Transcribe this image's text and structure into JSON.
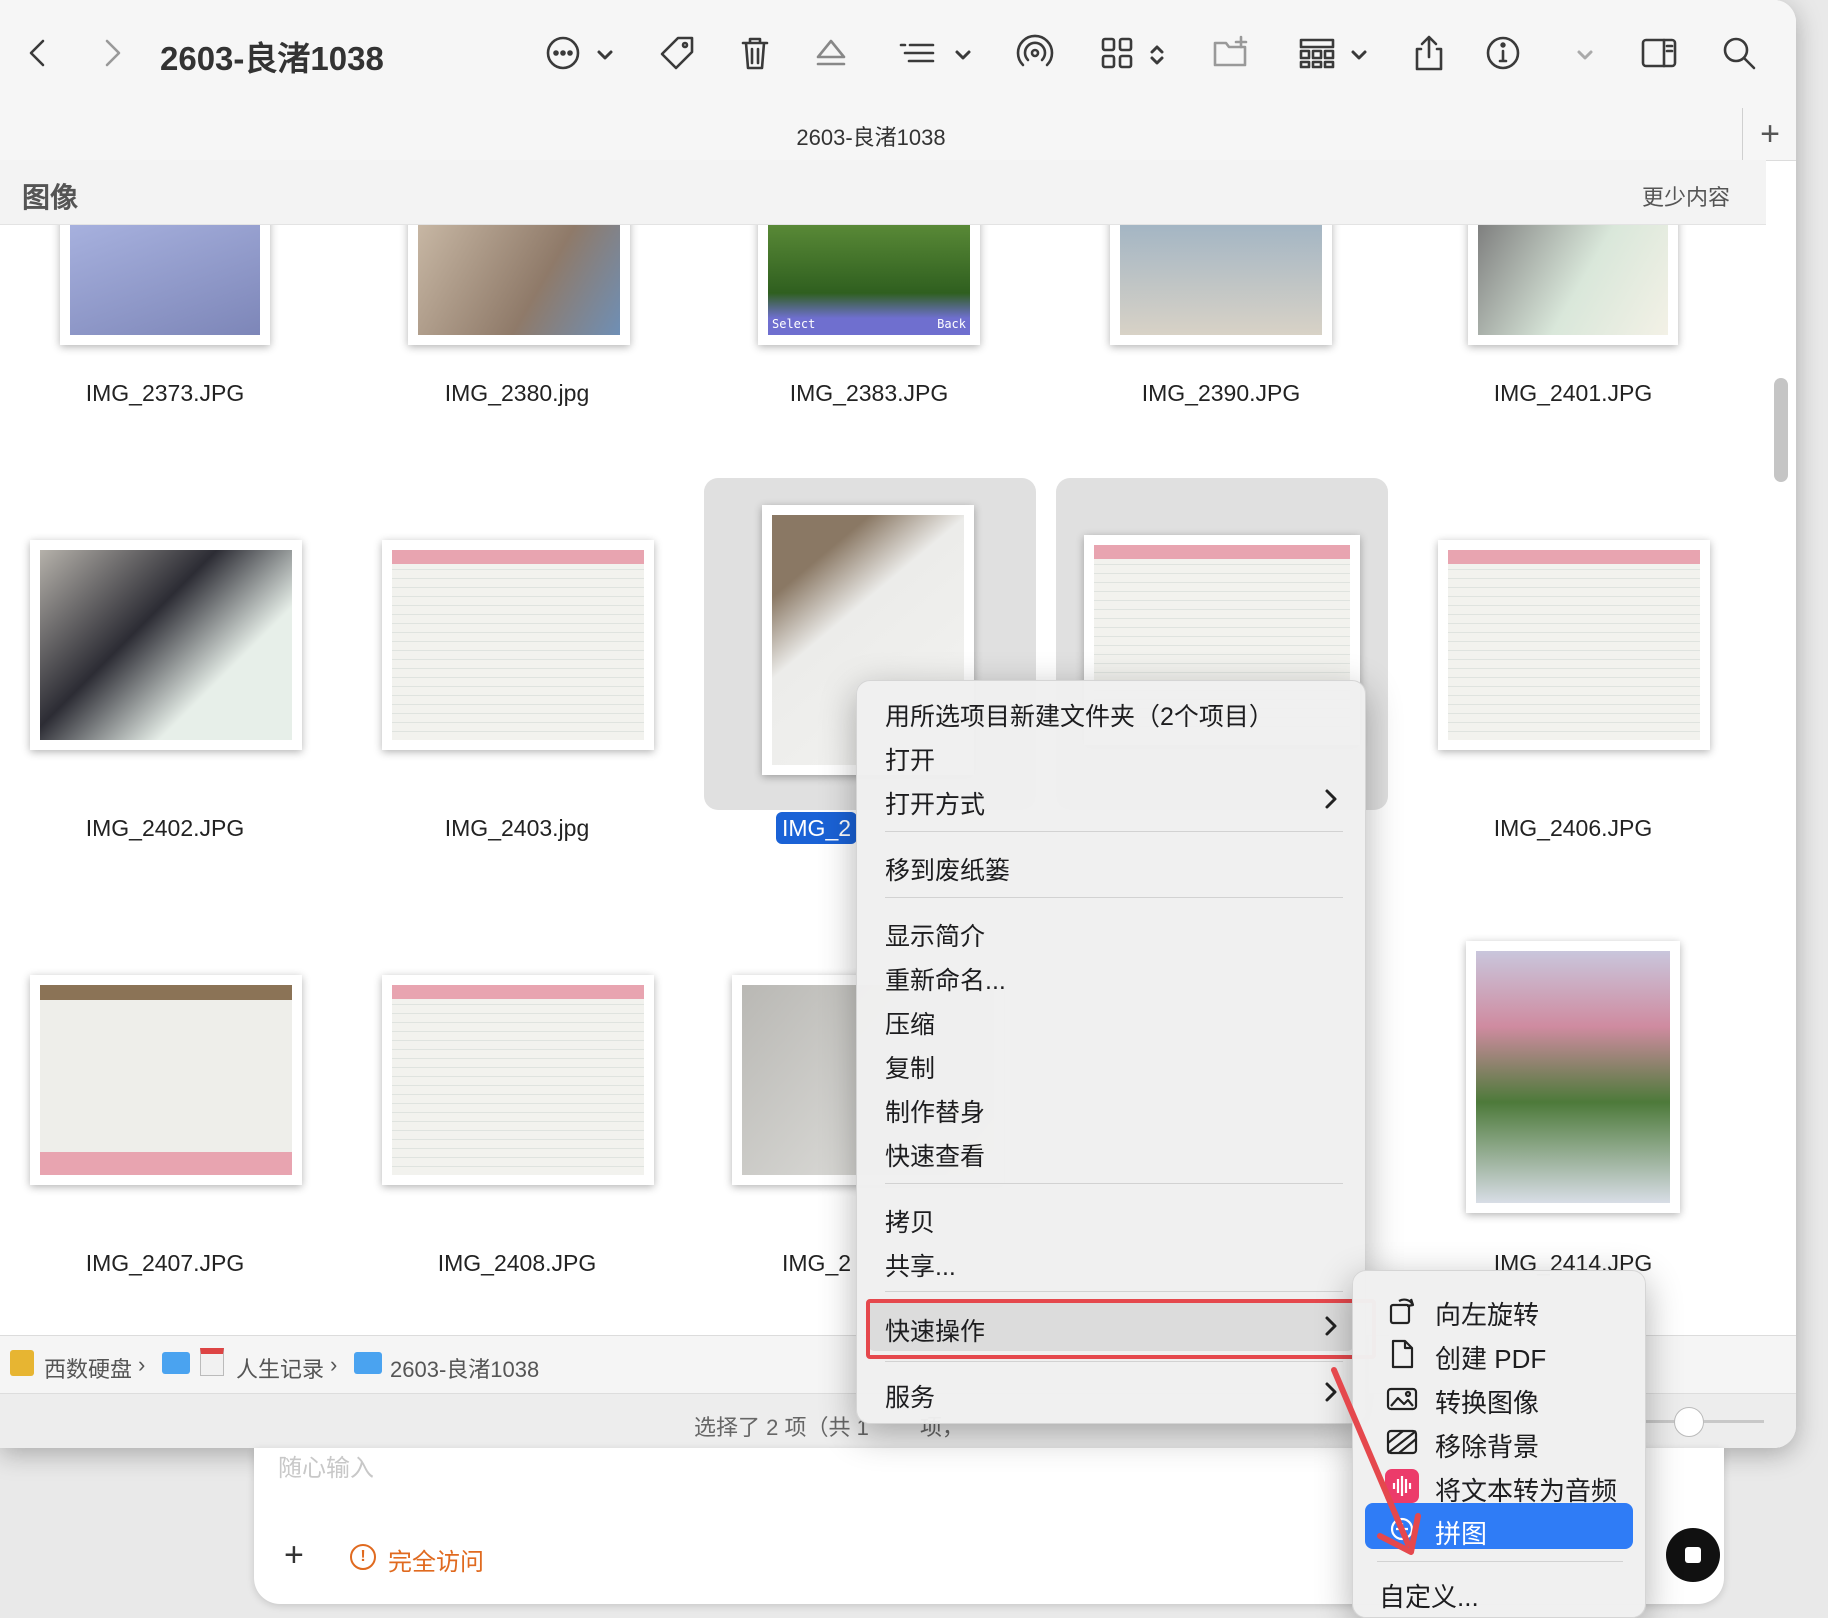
{
  "window": {
    "title": "2603-良渚1038",
    "tab_title": "2603-良渚1038",
    "tab_add": "+",
    "section_title": "图像",
    "section_less": "更少内容"
  },
  "toolbar_icons": [
    "back-icon",
    "forward-icon",
    "more-actions-icon",
    "tag-icon",
    "trash-icon",
    "eject-icon",
    "group-by-icon",
    "airdrop-icon",
    "view-mode-icon",
    "new-folder-icon",
    "gallery-view-icon",
    "share-icon",
    "info-icon",
    "sidebar-toggle-icon",
    "search-icon"
  ],
  "files": {
    "row1": [
      "IMG_2373.JPG",
      "IMG_2380.jpg",
      "IMG_2383.JPG",
      "IMG_2390.JPG",
      "IMG_2401.JPG"
    ],
    "row2": [
      "IMG_2402.JPG",
      "IMG_2403.jpg",
      "IMG_2",
      "",
      "IMG_2406.JPG"
    ],
    "row3": [
      "IMG_2407.JPG",
      "IMG_2408.JPG",
      "IMG_2",
      "",
      "IMG_2414.JPG"
    ],
    "thumb_caption_left": "Select",
    "thumb_caption_right": "Back"
  },
  "pathbar": [
    "西数硬盘",
    "人生记录",
    "2603-良渚1038"
  ],
  "status": "选择了 2 项（共 1",
  "status_tail": "项，",
  "background_app": {
    "placeholder": "随心输入",
    "add": "+",
    "access_label": "完全访问",
    "accent": "#e06a1f"
  },
  "context_menu": {
    "items": [
      {
        "label": "用所选项目新建文件夹（2个项目）"
      },
      {
        "label": "打开"
      },
      {
        "label": "打开方式",
        "submenu": true
      },
      {
        "label": "移到废纸篓"
      },
      {
        "label": "显示简介"
      },
      {
        "label": "重新命名..."
      },
      {
        "label": "压缩"
      },
      {
        "label": "复制"
      },
      {
        "label": "制作替身"
      },
      {
        "label": "快速查看"
      },
      {
        "label": "拷贝"
      },
      {
        "label": "共享..."
      },
      {
        "label": "快速操作",
        "submenu": true,
        "highlighted": true
      },
      {
        "label": "服务",
        "submenu": true
      }
    ]
  },
  "submenu": {
    "items": [
      {
        "label": "向左旋转",
        "icon": "rotate-left-icon"
      },
      {
        "label": "创建 PDF",
        "icon": "document-icon"
      },
      {
        "label": "转换图像",
        "icon": "convert-image-icon"
      },
      {
        "label": "移除背景",
        "icon": "remove-background-icon"
      },
      {
        "label": "将文本转为音频",
        "icon": "text-to-audio-icon"
      },
      {
        "label": "拼图",
        "icon": "puzzle-icon",
        "selected": true
      },
      {
        "label": "自定义..."
      }
    ],
    "highlight_color": "#2f7cf6"
  },
  "annotation_color": "#e5484d"
}
